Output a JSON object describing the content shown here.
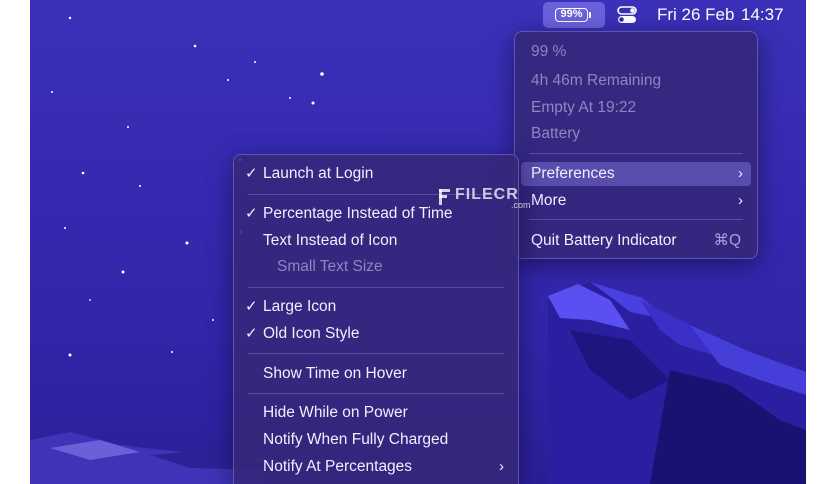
{
  "menubar": {
    "battery_percent": "99%",
    "date": "Fri 26 Feb",
    "time": "14:37",
    "icons": [
      "battery-icon",
      "control-center-icon"
    ]
  },
  "battery_menu": {
    "percent": "99 %",
    "remaining": "4h 46m Remaining",
    "empty_at": "Empty At 19:22",
    "battery": "Battery",
    "preferences": "Preferences",
    "more": "More",
    "quit": "Quit Battery Indicator",
    "quit_shortcut": "⌘Q"
  },
  "preferences_menu": {
    "launch_at_login": "Launch at Login",
    "percentage_instead_of_time": "Percentage Instead of Time",
    "text_instead_of_icon": "Text Instead of Icon",
    "small_text_size": "Small Text Size",
    "large_icon": "Large Icon",
    "old_icon_style": "Old Icon Style",
    "show_time_on_hover": "Show Time on Hover",
    "hide_while_on_power": "Hide While on Power",
    "notify_when_fully_charged": "Notify When Fully Charged",
    "notify_at_percentages": "Notify At Percentages",
    "checkmark": "✓",
    "checked": [
      "Launch at Login",
      "Percentage Instead of Time",
      "Large Icon",
      "Old Icon Style"
    ]
  },
  "watermark": {
    "text": "FILECR",
    "suffix": ".com"
  },
  "colors": {
    "wallpaper": "#3629b0",
    "menu_bg": "#342878",
    "highlight": "#786cd2",
    "battery_status_bg": "#6a62dc"
  }
}
